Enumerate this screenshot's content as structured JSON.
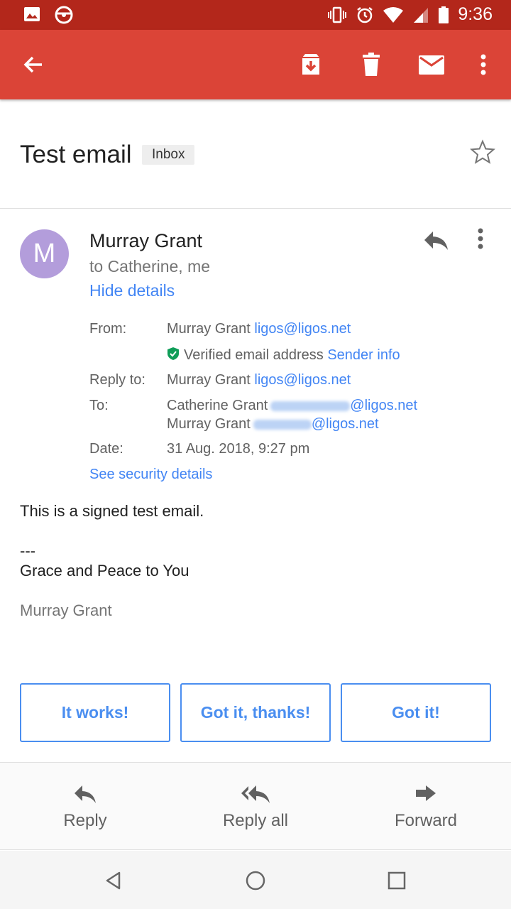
{
  "status_bar": {
    "time": "9:36"
  },
  "toolbar": {
    "icons": [
      "back-arrow-icon",
      "archive-icon",
      "delete-icon",
      "mark-unread-icon",
      "more-vert-icon"
    ]
  },
  "email": {
    "subject": "Test email",
    "label": "Inbox",
    "avatar_letter": "M",
    "avatar_color": "#b39ddb",
    "sender": "Murray Grant",
    "recipients_summary": "to Catherine, me",
    "hide_details": "Hide details",
    "details": {
      "from_label": "From:",
      "from_name": "Murray Grant",
      "from_email": "ligos@ligos.net",
      "verified_text": "Verified email address",
      "sender_info": "Sender info",
      "reply_to_label": "Reply to:",
      "reply_to_name": "Murray Grant",
      "reply_to_email": "ligos@ligos.net",
      "to_label": "To:",
      "to": [
        {
          "name": "Catherine Grant",
          "email_suffix": "@ligos.net"
        },
        {
          "name": "Murray Grant",
          "email_suffix": "@ligos.net"
        }
      ],
      "date_label": "Date:",
      "date": "31 Aug. 2018, 9:27 pm",
      "security_link": "See security details"
    },
    "body": {
      "line1": "This is a signed test email.",
      "separator": "---",
      "line2": "Grace and Peace to You",
      "signature": "Murray Grant"
    }
  },
  "smart_replies": [
    "It works!",
    "Got it, thanks!",
    "Got it!"
  ],
  "actions": [
    {
      "label": "Reply",
      "icon": "reply-icon"
    },
    {
      "label": "Reply all",
      "icon": "reply-all-icon"
    },
    {
      "label": "Forward",
      "icon": "forward-icon"
    }
  ],
  "colors": {
    "status_bar": "#b3271b",
    "toolbar": "#db4437",
    "link": "#4285f4",
    "verified": "#0f9d58"
  }
}
